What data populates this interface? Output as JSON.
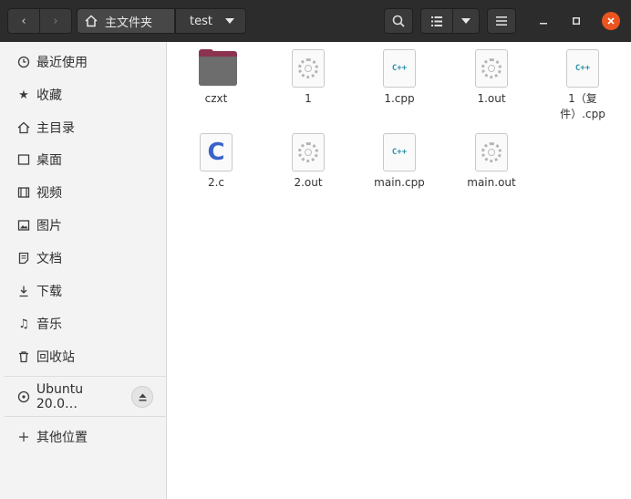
{
  "header": {
    "breadcrumb_home": "主文件夹",
    "breadcrumb_current": "test",
    "icons": {
      "back": "chevron-left-icon",
      "forward": "chevron-right-icon",
      "home": "home-icon",
      "dropdown": "chevron-down-icon",
      "search": "search-icon",
      "list_view": "list-view-icon",
      "view_options": "chevron-down-icon",
      "menu": "hamburger-menu-icon",
      "minimize": "minimize-icon",
      "maximize": "maximize-icon",
      "close": "close-icon"
    }
  },
  "sidebar": {
    "items": [
      {
        "label": "最近使用",
        "icon": "clock-icon"
      },
      {
        "label": "收藏",
        "icon": "star-icon"
      },
      {
        "label": "主目录",
        "icon": "home-icon"
      },
      {
        "label": "桌面",
        "icon": "desktop-icon"
      },
      {
        "label": "视频",
        "icon": "video-icon"
      },
      {
        "label": "图片",
        "icon": "picture-icon"
      },
      {
        "label": "文档",
        "icon": "document-icon"
      },
      {
        "label": "下载",
        "icon": "download-icon"
      },
      {
        "label": "音乐",
        "icon": "music-icon"
      },
      {
        "label": "回收站",
        "icon": "trash-icon"
      }
    ],
    "device": {
      "label": "Ubuntu 20.0…",
      "icon": "disc-icon",
      "eject_icon": "eject-icon"
    },
    "other_locations": {
      "label": "其他位置",
      "icon": "plus-icon"
    }
  },
  "files": [
    {
      "name": "czxt",
      "type": "folder"
    },
    {
      "name": "1",
      "type": "executable"
    },
    {
      "name": "1.cpp",
      "type": "cpp"
    },
    {
      "name": "1.out",
      "type": "executable"
    },
    {
      "name": "1（复件）.cpp",
      "type": "cpp"
    },
    {
      "name": "2.c",
      "type": "c"
    },
    {
      "name": "2.out",
      "type": "executable"
    },
    {
      "name": "main.cpp",
      "type": "cpp"
    },
    {
      "name": "main.out",
      "type": "executable"
    }
  ],
  "file_icon_text": {
    "cpp": "C++",
    "c": "C"
  },
  "colors": {
    "accent_close": "#e95420",
    "header_bg": "#2c2c2c",
    "folder": "#8c3350",
    "c_icon": "#3a63c9",
    "cpp_icon": "#2a8fa8"
  }
}
